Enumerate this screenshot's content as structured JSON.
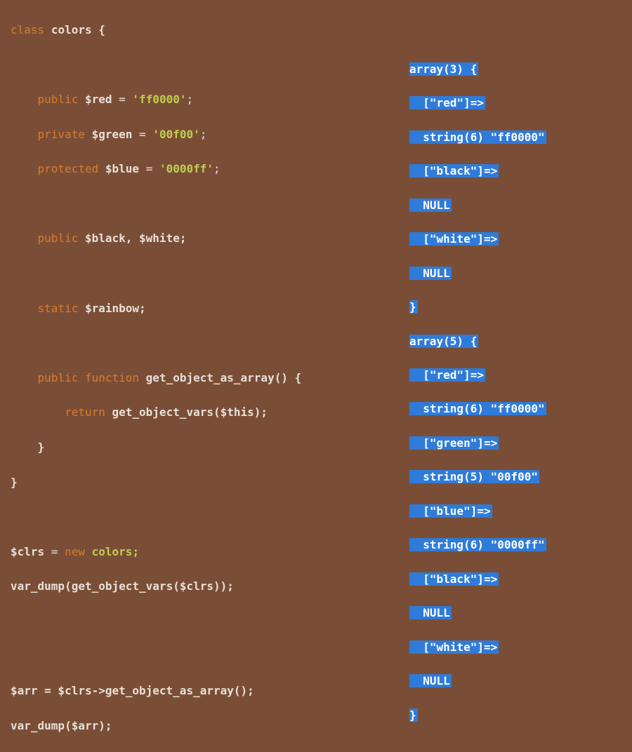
{
  "code": {
    "l1": {
      "kw": "class",
      "name": "colors",
      "brace": "{"
    },
    "l2": {
      "vis": "public",
      "var": "$red",
      "eq": "=",
      "str": "'ff0000'",
      "semi": ";"
    },
    "l3": {
      "vis": "private",
      "var": "$green",
      "eq": "=",
      "str": "'00f00'",
      "semi": ";"
    },
    "l4": {
      "vis": "protected",
      "var": "$blue",
      "eq": "=",
      "str": "'0000ff'",
      "semi": ";"
    },
    "l5": {
      "vis": "public",
      "vars": "$black, $white;"
    },
    "l6": {
      "vis": "static",
      "var": "$rainbow;"
    },
    "l7": {
      "vis": "public",
      "kw": "function",
      "name": "get_object_as_array",
      "paren": "() {"
    },
    "l8": {
      "kw": "return",
      "call": "get_object_vars",
      "arg": "($this);"
    },
    "l9": "}",
    "l10": "}",
    "l11": {
      "var": "$clrs",
      "eq": "=",
      "kw": "new",
      "name": "colors;"
    },
    "l12": {
      "call": "var_dump",
      "open": "(",
      "inner": "get_object_vars",
      "arg": "($clrs));"
    },
    "l13": {
      "lhs": "$arr = $clrs->",
      "call": "get_object_as_array",
      "tail": "();"
    },
    "l14": {
      "call": "var_dump",
      "arg": "($arr);"
    }
  },
  "output": {
    "o1": "array(3) {",
    "o2": "  [\"red\"]=>",
    "o3": "  string(6) \"ff0000\"",
    "o4": "  [\"black\"]=>",
    "o5": "  NULL",
    "o6": "  [\"white\"]=>",
    "o7": "  NULL",
    "o8": "}",
    "o9": "array(5) {",
    "o10": "  [\"red\"]=>",
    "o11": "  string(6) \"ff0000\"",
    "o12": "  [\"green\"]=>",
    "o13": "  string(5) \"00f00\"",
    "o14": "  [\"blue\"]=>",
    "o15": "  string(6) \"0000ff\"",
    "o16": "  [\"black\"]=>",
    "o17": "  NULL",
    "o18": "  [\"white\"]=>",
    "o19": "  NULL",
    "o20": "}"
  }
}
